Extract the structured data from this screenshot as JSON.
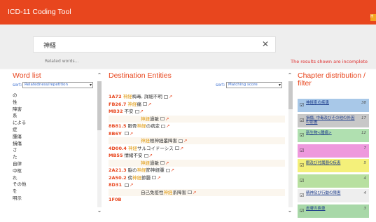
{
  "app": {
    "title": "ICD-11 Coding Tool",
    "help_tab": "H",
    "accent_color": "#e8461e"
  },
  "search": {
    "value": "神経",
    "clear_icon": "close-icon",
    "related_words": "Related words...",
    "incomplete_note": "The results shown are incomplete"
  },
  "word_list": {
    "title": "Word list",
    "sort_label": "sort:",
    "sort_value": "Relatedness/repetition",
    "items": [
      "の",
      "性",
      "障害",
      "系",
      "による",
      "症",
      "腫瘍",
      "損傷",
      "さ",
      "た",
      "自律",
      "中枢",
      "れ",
      "その他",
      "を",
      "明示"
    ]
  },
  "destination": {
    "title": "Destination Entities",
    "sort_label": "sort:",
    "sort_value": "Matching score",
    "rows": [
      {
        "code": "1A72",
        "pre": "",
        "hl": "神経",
        "post": "梅毒, 詳細不明",
        "icons": true
      },
      {
        "code": "FB26.7",
        "pre": "",
        "hl": "神経",
        "post": "痛",
        "icons": true
      },
      {
        "code": "MB32",
        "pre": "不安",
        "hl": "",
        "post": "",
        "icons": true
      },
      {
        "code": "",
        "pre": "",
        "hl": "神経",
        "post": "過敏",
        "icons": true
      },
      {
        "code": "8B81.5",
        "pre": "眼骨",
        "hl": "神経",
        "post": "の病変",
        "icons": true
      },
      {
        "code": "8B6Y",
        "pre": "",
        "hl": "",
        "post": "",
        "icons": true
      },
      {
        "code": "",
        "pre": "",
        "hl": "神経",
        "post": "根神経叢障害",
        "icons": true
      },
      {
        "code": "4D00.4",
        "pre": "",
        "hl": "神経",
        "post": "サルコイドーシス",
        "icons": true
      },
      {
        "code": "MB55",
        "pre": "情緒不安",
        "hl": "",
        "post": "",
        "icons": true
      },
      {
        "code": "",
        "pre": "",
        "hl": "神経",
        "post": "過敏",
        "icons": true
      },
      {
        "code": "2A21.3",
        "pre": "脳の",
        "hl": "神経",
        "post": "節神経腫",
        "icons": true
      },
      {
        "code": "2A50.2",
        "pre": "傍",
        "hl": "神経",
        "post": "節腫",
        "icons": true
      },
      {
        "code": "8D31",
        "pre": "",
        "hl": "",
        "post": "",
        "icons": true
      },
      {
        "code": "",
        "pre": "自己免疫性",
        "hl": "神経",
        "post": "系障害",
        "icons": true
      },
      {
        "code": "1F0B",
        "pre": "",
        "hl": "",
        "post": "",
        "icons": false
      }
    ]
  },
  "chapters": {
    "title": "Chapter distribution / filter",
    "items": [
      {
        "label": "神経系の疾患",
        "count": "38",
        "color": "#a8c8e8"
      },
      {
        "label": "損傷, 中毒及びその他の外因の影響",
        "count": "17",
        "color": "#c8c8c8"
      },
      {
        "label": "新生物<腫瘍>",
        "count": "12",
        "color": "#b0e0b0"
      },
      {
        "label": "",
        "count": "7",
        "color": "#ee99dd"
      },
      {
        "label": "眼及び付属器の疾患",
        "count": "5",
        "color": "#f4f07a"
      },
      {
        "label": "",
        "count": "4",
        "color": "#b8e0a0"
      },
      {
        "label": "精神及び行動の障害",
        "count": "4",
        "color": "#eeeeee"
      },
      {
        "label": "皮膚の疾患",
        "count": "3",
        "color": "#a8d8a8"
      }
    ]
  }
}
